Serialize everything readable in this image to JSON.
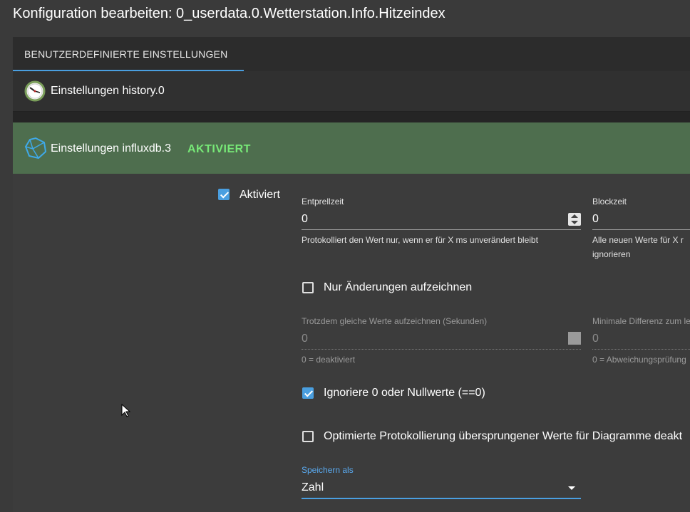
{
  "dialog": {
    "title": "Konfiguration bearbeiten: 0_userdata.0.Wetterstation.Info.Hitzeindex"
  },
  "tabs": [
    {
      "label": "BENUTZERDEFINIERTE EINSTELLUNGEN",
      "active": true
    }
  ],
  "history_panel": {
    "label": "Einstellungen history.0",
    "icon": "clock-icon"
  },
  "influx_panel": {
    "label": "Einstellungen influxdb.3",
    "status": "AKTIVIERT",
    "icon": "influxdb-icon",
    "status_color": "#77e877"
  },
  "form": {
    "enabled": {
      "label": "Aktiviert",
      "checked": true
    },
    "debounce": {
      "label": "Entprellzeit",
      "value": "0",
      "helper": "Protokolliert den Wert nur, wenn er für X ms unverändert bleibt"
    },
    "blocktime": {
      "label": "Blockzeit",
      "value": "0",
      "helper_line1": "Alle neuen Werte für X r",
      "helper_line2": "ignorieren"
    },
    "changes_only": {
      "label": "Nur Änderungen aufzeichnen",
      "checked": false
    },
    "same_values": {
      "label": "Trotzdem gleiche Werte aufzeichnen (Sekunden)",
      "value": "0",
      "helper": "0 = deaktiviert"
    },
    "min_diff": {
      "label": "Minimale Differenz zum le",
      "value": "0",
      "helper": "0 = Abweichungsprüfung"
    },
    "ignore_zero": {
      "label": "Ignoriere 0 oder Nullwerte (==0)",
      "checked": true
    },
    "optimized": {
      "label": "Optimierte Protokollierung übersprungener Werte für Diagramme deakt",
      "checked": false
    },
    "store_as": {
      "label": "Speichern als",
      "value": "Zahl"
    }
  },
  "colors": {
    "accent": "#4a9fe0",
    "active_panel": "#4e6e4e",
    "background": "#3a3a3a"
  }
}
